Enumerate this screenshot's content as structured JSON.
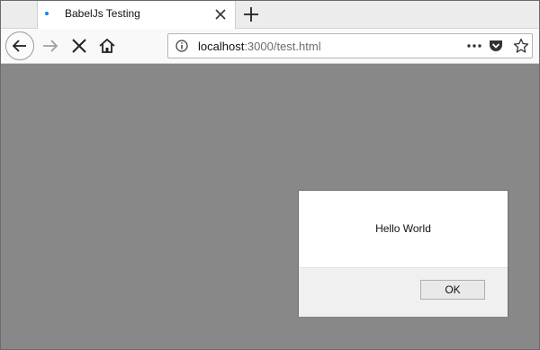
{
  "browser": {
    "tab": {
      "title": "BabelJs Testing",
      "loading_indicator": "loading-dot",
      "accent_color": "#0a84ff"
    },
    "toolbar": {
      "back_icon": "back-arrow-icon",
      "forward_icon": "forward-arrow-icon",
      "stop_icon": "stop-icon",
      "home_icon": "home-icon"
    },
    "urlbar": {
      "host": "localhost",
      "path": ":3000/test.html",
      "info_icon": "info-icon",
      "menu_icon": "more-dots-icon",
      "pocket_icon": "pocket-icon",
      "bookmark_icon": "star-icon"
    }
  },
  "page": {
    "background_color": "#888888"
  },
  "alert": {
    "message": "Hello World",
    "ok_label": "OK"
  }
}
